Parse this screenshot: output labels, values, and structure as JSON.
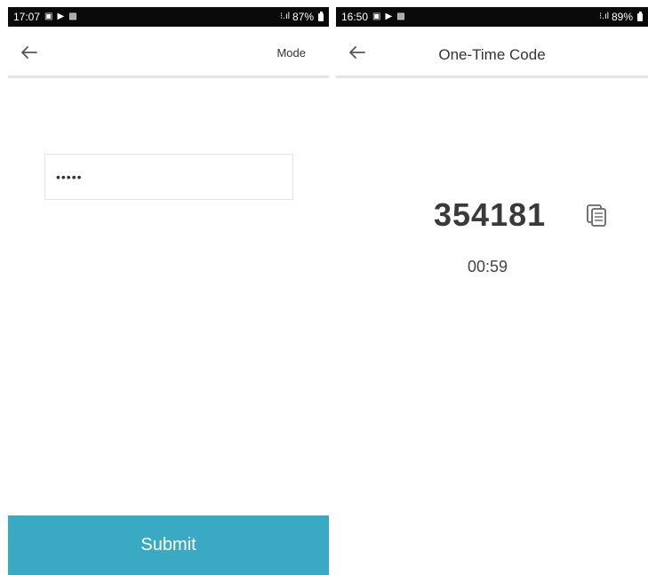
{
  "left_screen": {
    "status_bar": {
      "time": "17:07",
      "battery": "87%"
    },
    "header": {
      "mode_label": "Mode"
    },
    "pin_input": {
      "value": "•••••"
    },
    "submit_label": "Submit"
  },
  "right_screen": {
    "status_bar": {
      "time": "16:50",
      "battery": "89%"
    },
    "header": {
      "title": "One-Time Code"
    },
    "code": "354181",
    "countdown": "00:59"
  },
  "colors": {
    "accent": "#3aa9c4",
    "status_bar_bg": "#0a0a0a",
    "divider": "#e4e4e4"
  },
  "icons": {
    "back": "arrow-left-icon",
    "copy": "copy-icon",
    "battery": "battery-icon",
    "signal": "signal-icon",
    "gallery": "image-icon",
    "play": "play-icon"
  }
}
